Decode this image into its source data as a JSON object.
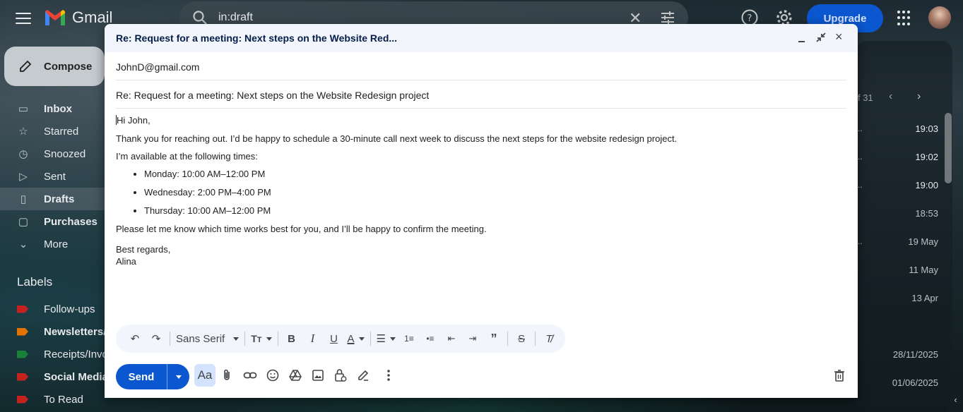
{
  "app": {
    "name": "Gmail",
    "upgrade_label": "Upgrade"
  },
  "search": {
    "value": "in:draft"
  },
  "sidebar": {
    "compose_label": "Compose",
    "items": [
      {
        "label": "Inbox",
        "icon": "inbox-icon"
      },
      {
        "label": "Starred",
        "icon": "star-icon"
      },
      {
        "label": "Snoozed",
        "icon": "clock-icon"
      },
      {
        "label": "Sent",
        "icon": "send-icon"
      },
      {
        "label": "Drafts",
        "icon": "draft-icon"
      },
      {
        "label": "Purchases",
        "icon": "bag-icon"
      },
      {
        "label": "More",
        "icon": "chevron-down-icon"
      }
    ],
    "labels_title": "Labels",
    "labels": [
      {
        "label": "Follow-ups",
        "color": "#c5221f"
      },
      {
        "label": "Newsletters/",
        "color": "#e37400"
      },
      {
        "label": "Receipts/Invo",
        "color": "#188038"
      },
      {
        "label": "Social Media",
        "color": "#c5221f"
      },
      {
        "label": "To Read",
        "color": "#c5221f"
      }
    ]
  },
  "mail_list": {
    "pager": "f 31",
    "rows": [
      {
        "time": "19:03"
      },
      {
        "time": "19:02"
      },
      {
        "time": "19:00"
      },
      {
        "time": "18:53"
      },
      {
        "time": "19 May"
      },
      {
        "time": "11 May"
      },
      {
        "time": "13 Apr"
      },
      {
        "time": ""
      },
      {
        "time": "28/11/2025"
      },
      {
        "time": "01/06/2025"
      }
    ]
  },
  "compose": {
    "title": "Re: Request for a meeting: Next steps on the Website Red...",
    "to": "JohnD@gmail.com",
    "subject": "Re: Request for a meeting: Next steps on the Website Redesign project",
    "body": {
      "greeting": "Hi John,",
      "p1": "Thank you for reaching out. I’d be happy to schedule a 30-minute call next week to discuss the next steps for the website redesign project.",
      "p2": "I’m available at the following times:",
      "times": [
        "Monday: 10:00 AM–12:00 PM",
        "Wednesday: 2:00 PM–4:00 PM",
        "Thursday: 10:00 AM–12:00 PM"
      ],
      "p3": "Please let me know which time works best for you, and I’ll be happy to confirm the meeting.",
      "closing": "Best regards,",
      "signature": "Alina"
    },
    "toolbar": {
      "font": "Sans Serif"
    },
    "send_label": "Send",
    "aa_label": "Aa"
  },
  "colors": {
    "accent": "#0b57d0",
    "compose_header": "#f2f6fc"
  }
}
